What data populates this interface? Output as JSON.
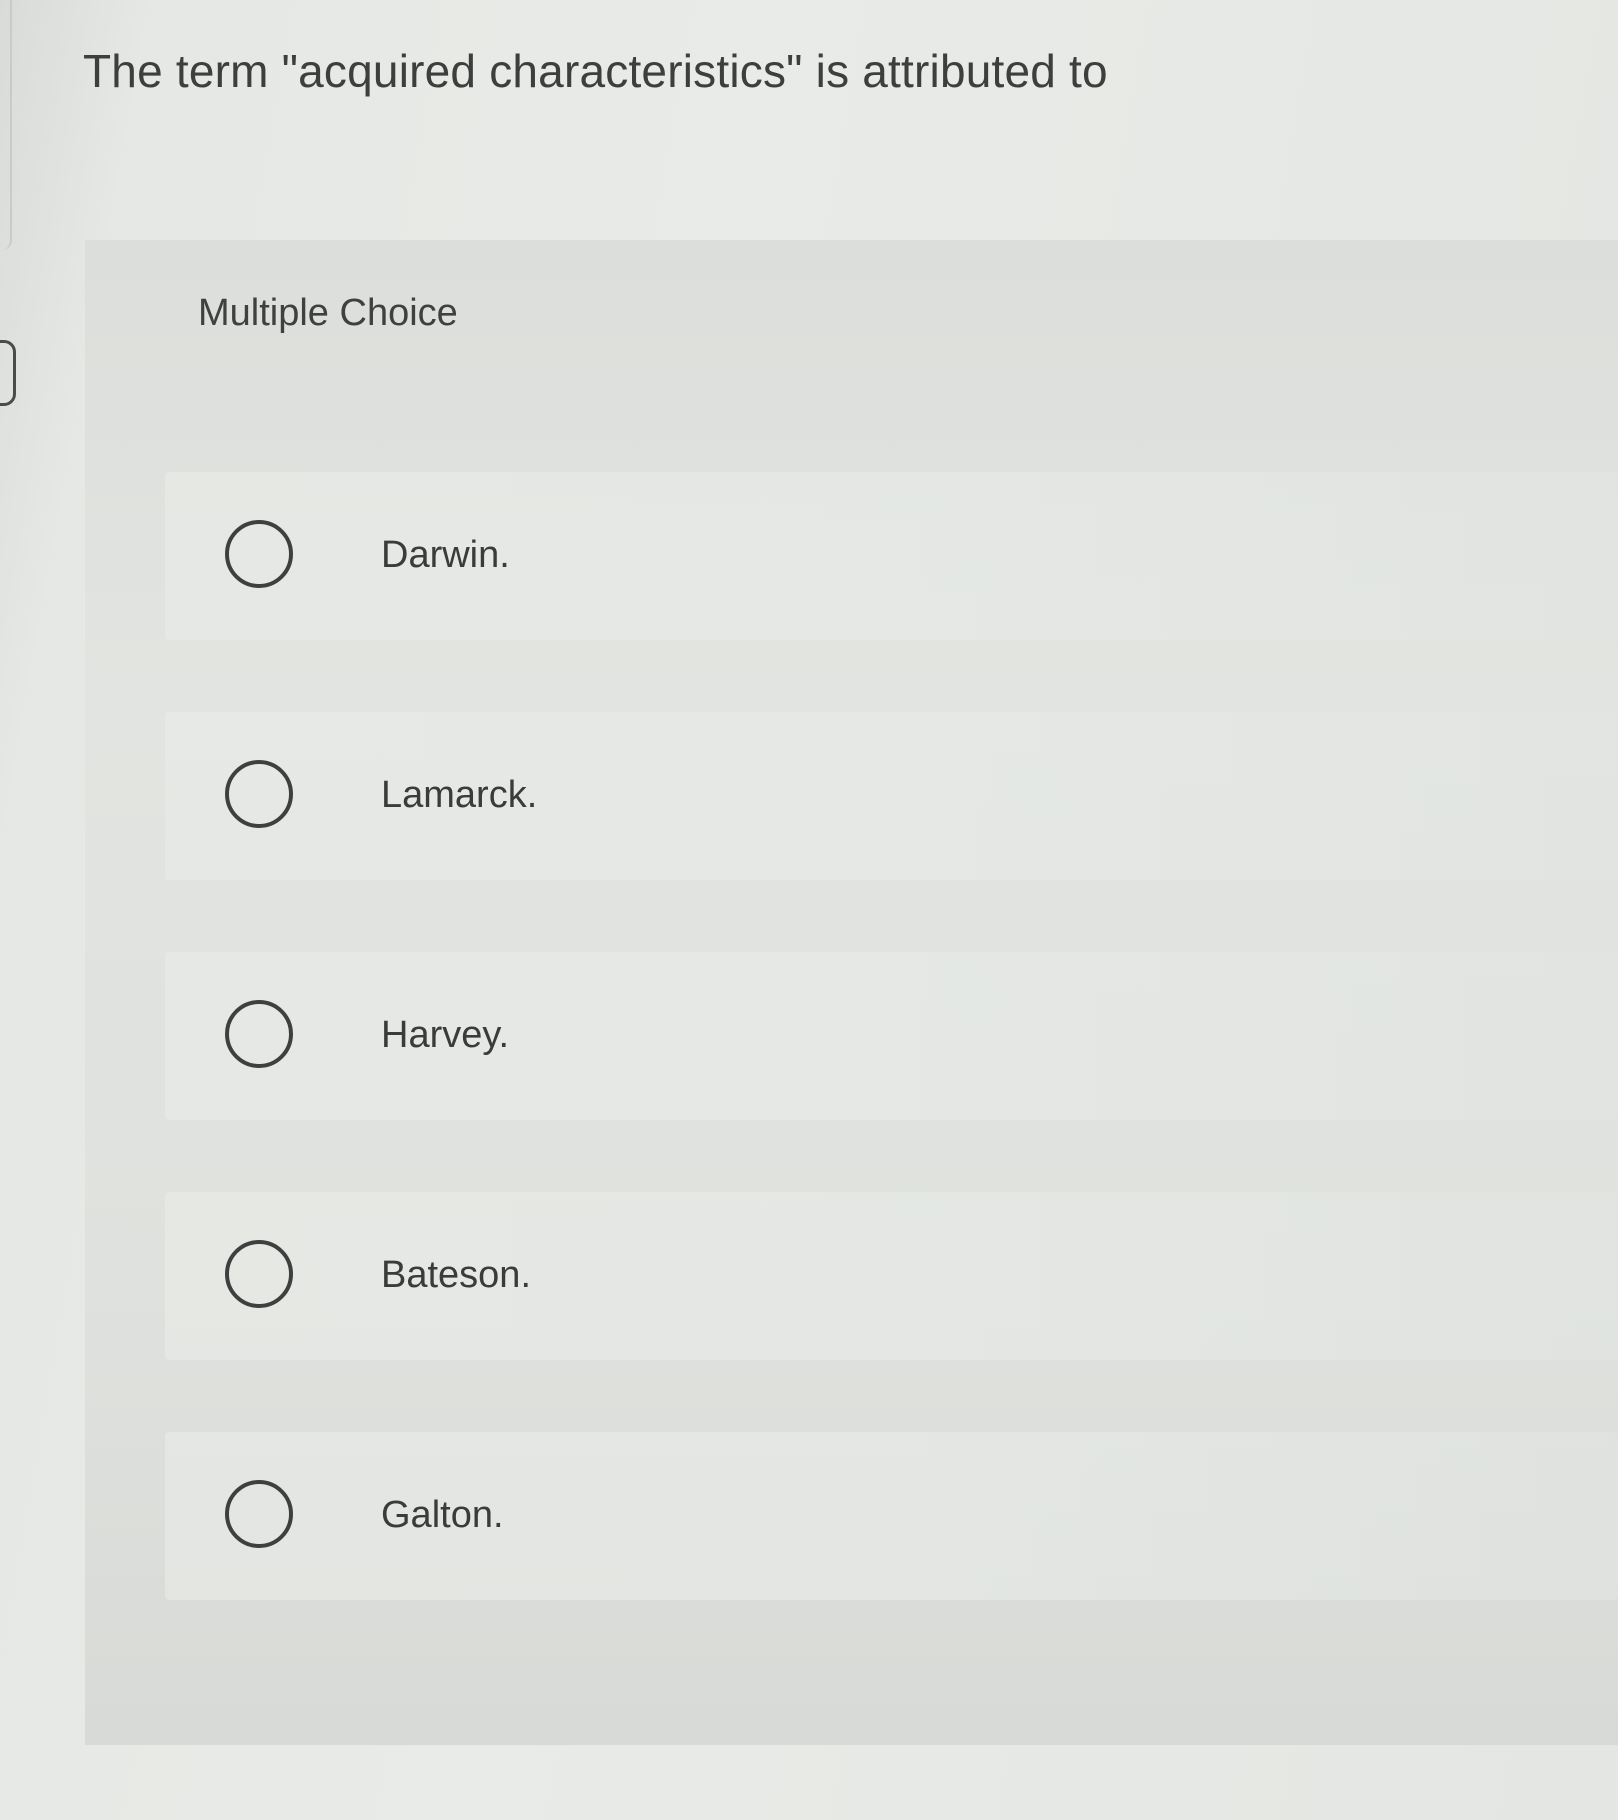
{
  "question": {
    "text": "The term \"acquired characteristics\" is attributed to"
  },
  "panel": {
    "label": "Multiple Choice"
  },
  "options": [
    {
      "label": "Darwin.",
      "selected": false
    },
    {
      "label": "Lamarck.",
      "selected": false
    },
    {
      "label": "Harvey.",
      "selected": false
    },
    {
      "label": "Bateson.",
      "selected": false
    },
    {
      "label": "Galton.",
      "selected": false
    }
  ]
}
